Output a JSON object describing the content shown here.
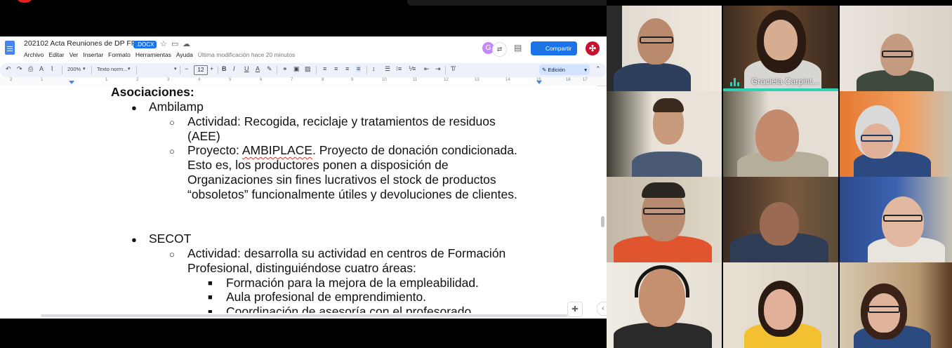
{
  "document": {
    "title": "202102 Acta Reuniones de DP FP",
    "badge": ".DOCX",
    "menu": [
      "Archivo",
      "Editar",
      "Ver",
      "Insertar",
      "Formato",
      "Herramientas",
      "Ayuda"
    ],
    "last_edit": "Última modificación hace 20 minutos",
    "share_label": "Compartir",
    "avatar_initial": "G",
    "toolbar": {
      "zoom": "200%",
      "style": "Texto norm...",
      "font_size": "12",
      "mode": "Edición"
    },
    "ruler_numbers": [
      "2",
      "1",
      "1",
      "2",
      "3",
      "4",
      "5",
      "6",
      "7",
      "8",
      "9",
      "10",
      "11",
      "12",
      "13",
      "14",
      "15",
      "16",
      "17"
    ],
    "content": {
      "heading": "Asociaciones:",
      "org1": "Ambilamp",
      "org1_activity_1": "Actividad: Recogida, reciclaje y tratamientos de residuos",
      "org1_activity_2": "(AEE)",
      "org1_project_prefix": "Proyecto: ",
      "org1_project_name": "AMBIPLACE",
      "org1_project_suffix": ". Proyecto de donación condicionada.",
      "org1_project_2": "Esto es, los productores ponen a disposición de",
      "org1_project_3": "Organizaciones sin fines lucrativos el stock de productos",
      "org1_project_4": "“obsoletos” funcionalmente útiles y devoluciones de clientes.",
      "org2": "SECOT",
      "org2_activity_1": "Actividad: desarrolla su actividad en centros de Formación",
      "org2_activity_2": "Profesional, distinguiéndose cuatro áreas:",
      "org2_area_1": "Formación para la mejora de la empleabilidad.",
      "org2_area_2": "Aula profesional de emprendimiento.",
      "org2_area_3": "Coordinación de asesoría con el profesorado."
    }
  },
  "video_call": {
    "active_speaker_name": "Graciela Carpint...",
    "speaker_color": "#2fd0b4"
  },
  "colors": {
    "accent": "#1a73e8",
    "toolbar_bg": "#edf2fa",
    "brand": "#c8102e"
  }
}
